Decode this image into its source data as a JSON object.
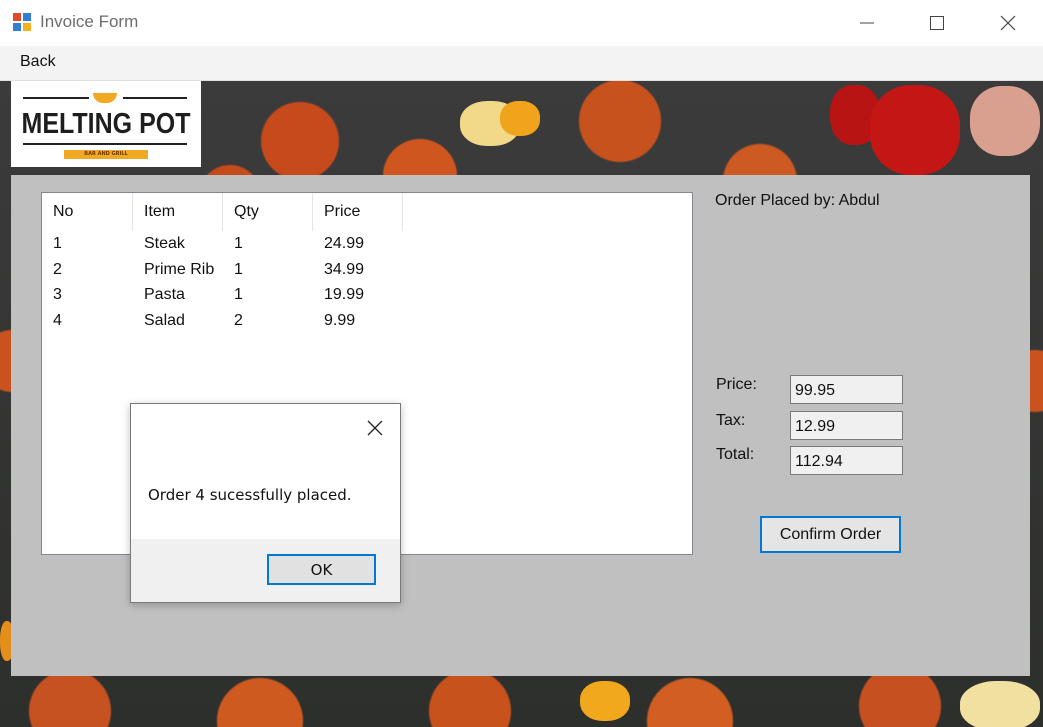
{
  "window": {
    "title": "Invoice Form",
    "icon": "form-app-icon",
    "controls": [
      "minimize-icon",
      "maximize-icon",
      "close-icon"
    ]
  },
  "menu": {
    "back_label": "Back"
  },
  "logo": {
    "name": "MELTING POT",
    "tagline": "BAR AND GRILL"
  },
  "order_list": {
    "columns": [
      "No",
      "Item",
      "Qty",
      "Price"
    ],
    "rows": [
      {
        "no": "1",
        "item": "Steak",
        "qty": "1",
        "price": "24.99"
      },
      {
        "no": "2",
        "item": "Prime Rib",
        "qty": "1",
        "price": "34.99"
      },
      {
        "no": "3",
        "item": "Pasta",
        "qty": "1",
        "price": "19.99"
      },
      {
        "no": "4",
        "item": "Salad",
        "qty": "2",
        "price": "9.99"
      }
    ]
  },
  "summary": {
    "placed_by": "Order Placed by: Abdul",
    "price_label": "Price:",
    "price_value": "99.95",
    "tax_label": "Tax:",
    "tax_value": "12.99",
    "total_label": "Total:",
    "total_value": "112.94",
    "confirm_label": "Confirm Order"
  },
  "dialog": {
    "message": "Order 4 sucessfully placed.",
    "ok_label": "OK"
  },
  "colors": {
    "panel": "#c0c0c0",
    "accent": "#0078d7",
    "logo_accent": "#f2a822"
  }
}
